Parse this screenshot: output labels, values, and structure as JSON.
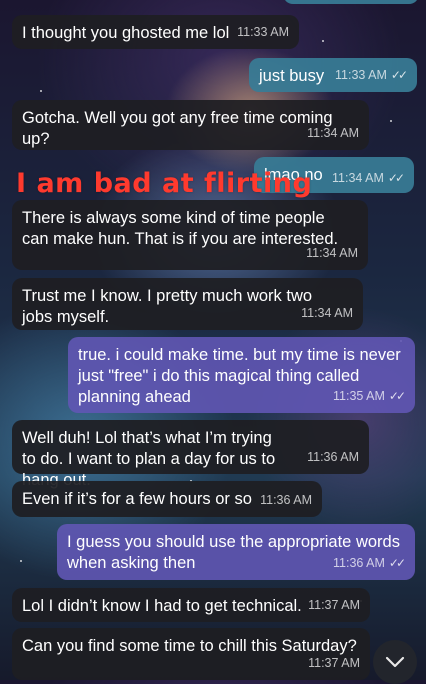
{
  "overlay_caption": "I am bad at flirting",
  "messages": [
    {
      "text": "I thought you ghosted me lol",
      "time": "11:33 AM"
    },
    {
      "text": "just busy",
      "time": "11:33 AM"
    },
    {
      "text": "Gotcha. Well you got any free time coming up?",
      "time": "11:34 AM"
    },
    {
      "text": "lmao no",
      "time": "11:34 AM"
    },
    {
      "text": "There is always some kind of time people can make hun. That is if you are interested.",
      "time": "11:34 AM"
    },
    {
      "text": "Trust me I know. I pretty much work two jobs myself.",
      "time": "11:34 AM"
    },
    {
      "text": "true. i could make time. but my time is never just \"free\" i do this magical thing called planning ahead",
      "time": "11:35 AM"
    },
    {
      "text": "Well duh! Lol that’s what I’m trying to do. I want to plan a day for us to hang out.",
      "time": "11:36 AM"
    },
    {
      "text": "Even if it’s for a few hours or so",
      "time": "11:36 AM"
    },
    {
      "text": "I guess you should use the appropriate words when asking then",
      "time": "11:36 AM"
    },
    {
      "text": "Lol I didn’t know I had to get technical.",
      "time": "11:37 AM"
    },
    {
      "text": "Can you find some time to chill this Saturday?",
      "time": "11:37 AM"
    }
  ],
  "colors": {
    "incoming_bubble": "#1e1e22",
    "outgoing_bubble": "#387c96",
    "outgoing_bubble_alt": "#6056b4",
    "caption": "#ff3a2e"
  },
  "icons": {
    "read_receipt": "double-check-icon",
    "scroll_down": "chevron-down-icon"
  }
}
